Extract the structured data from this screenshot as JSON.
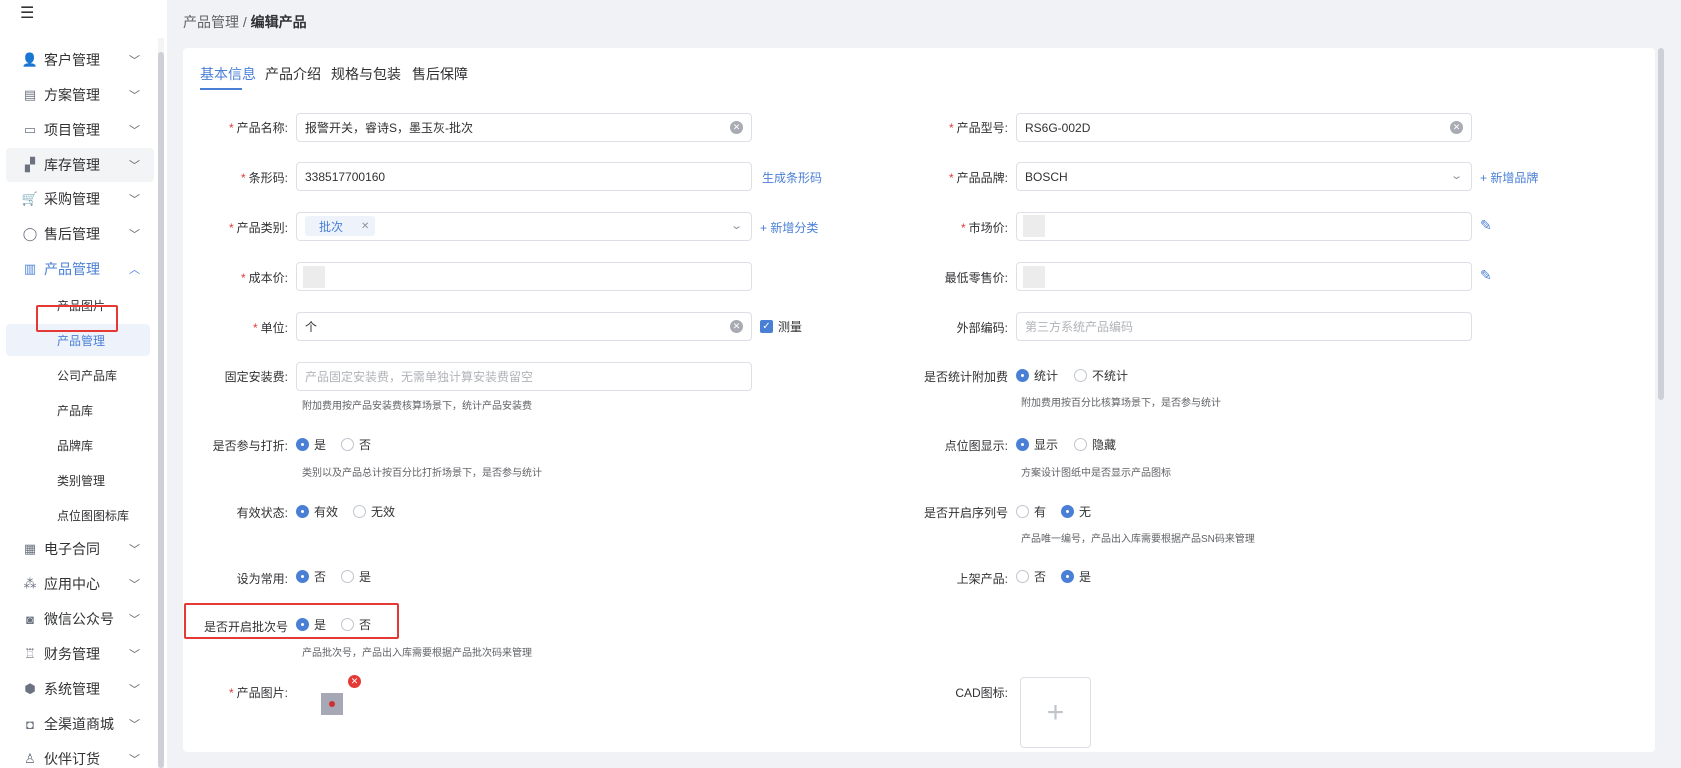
{
  "sidebar": {
    "collapse_icon": "☰",
    "menu": [
      {
        "label": "客户管理",
        "icon": "customer-icon",
        "glyph": "👤"
      },
      {
        "label": "方案管理",
        "icon": "plan-icon",
        "glyph": "▤"
      },
      {
        "label": "项目管理",
        "icon": "folder-icon",
        "glyph": "▭"
      },
      {
        "label": "库存管理",
        "icon": "inventory-icon",
        "glyph": "▞"
      },
      {
        "label": "采购管理",
        "icon": "cart-icon",
        "glyph": "🛒"
      },
      {
        "label": "售后管理",
        "icon": "headset-icon",
        "glyph": "◯"
      },
      {
        "label": "产品管理",
        "icon": "product-icon",
        "glyph": "▥"
      },
      {
        "label": "电子合同",
        "icon": "contract-icon",
        "glyph": "▦"
      },
      {
        "label": "应用中心",
        "icon": "apps-icon",
        "glyph": "⁂"
      },
      {
        "label": "微信公众号",
        "icon": "wechat-icon",
        "glyph": "◙"
      },
      {
        "label": "财务管理",
        "icon": "finance-icon",
        "glyph": "♖"
      },
      {
        "label": "系统管理",
        "icon": "settings-icon",
        "glyph": "⬢"
      },
      {
        "label": "全渠道商城",
        "icon": "mall-icon",
        "glyph": "◘"
      },
      {
        "label": "伙伴订货",
        "icon": "partner-icon",
        "glyph": "♙"
      }
    ],
    "sub_menu": [
      "产品图片",
      "产品管理",
      "公司产品库",
      "产品库",
      "品牌库",
      "类别管理",
      "点位图图标库"
    ]
  },
  "breadcrumb": {
    "parent": "产品管理",
    "sep": "/",
    "current": "编辑产品"
  },
  "tabs": [
    "基本信息",
    "产品介绍",
    "规格与包装",
    "售后保障"
  ],
  "form": {
    "name_label": "产品名称:",
    "name_value": "报警开关，睿诗S，墨玉灰-批次",
    "model_label": "产品型号:",
    "model_value": "RS6G-002D",
    "barcode_label": "条形码:",
    "barcode_value": "338517700160",
    "barcode_link": "生成条形码",
    "brand_label": "产品品牌:",
    "brand_value": "BOSCH",
    "brand_link": "+ 新增品牌",
    "category_label": "产品类别:",
    "category_tag": "批次",
    "category_link": "+ 新增分类",
    "market_price_label": "市场价:",
    "cost_price_label": "成本价:",
    "min_retail_label": "最低零售价:",
    "unit_label": "单位:",
    "unit_value": "个",
    "measure_label": "测量",
    "ext_code_label": "外部编码:",
    "ext_code_placeholder": "第三方系统产品编码",
    "install_fee_label": "固定安装费:",
    "install_fee_placeholder": "产品固定安装费，无需单独计算安装费留空",
    "install_fee_hint": "附加费用按产品安装费核算场景下，统计产品安装费",
    "surcharge_label": "是否统计附加费",
    "surcharge_opts": [
      "统计",
      "不统计"
    ],
    "surcharge_hint": "附加费用按百分比核算场景下，是否参与统计",
    "discount_label": "是否参与打折:",
    "discount_opts": [
      "是",
      "否"
    ],
    "discount_hint": "类别以及产品总计按百分比打折场景下，是否参与统计",
    "point_label": "点位图显示:",
    "point_opts": [
      "显示",
      "隐藏"
    ],
    "point_hint": "方案设计图纸中是否显示产品图标",
    "status_label": "有效状态:",
    "status_opts": [
      "有效",
      "无效"
    ],
    "serial_label": "是否开启序列号",
    "serial_opts": [
      "有",
      "无"
    ],
    "serial_hint": "产品唯一编号，产品出入库需要根据产品SN码来管理",
    "common_label": "设为常用:",
    "common_opts": [
      "否",
      "是"
    ],
    "shelf_label": "上架产品:",
    "shelf_opts": [
      "否",
      "是"
    ],
    "batch_label": "是否开启批次号",
    "batch_opts": [
      "是",
      "否"
    ],
    "batch_hint": "产品批次号，产品出入库需要根据产品批次码来管理",
    "image_label": "产品图片:",
    "cad_label": "CAD图标:",
    "required_mark": "*",
    "plus": "+"
  }
}
